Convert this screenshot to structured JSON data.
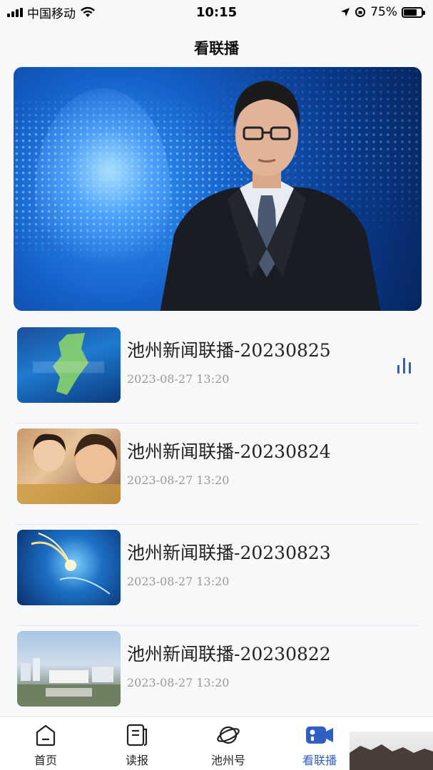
{
  "status_bar": {
    "carrier": "中国移动",
    "time": "10:15",
    "battery": "75%",
    "battery_level": 0.75
  },
  "header": {
    "title": "看联播"
  },
  "hero": {
    "icon": "video-player"
  },
  "news": [
    {
      "title": "池州新闻联播-20230825",
      "time": "2023-08-27 13:20",
      "playing": true
    },
    {
      "title": "池州新闻联播-20230824",
      "time": "2023-08-27 13:20",
      "playing": false
    },
    {
      "title": "池州新闻联播-20230823",
      "time": "2023-08-27 13:20",
      "playing": false
    },
    {
      "title": "池州新闻联播-20230822",
      "time": "2023-08-27 13:20",
      "playing": false
    }
  ],
  "tabs": [
    {
      "label": "首页",
      "icon": "home-icon",
      "active": false
    },
    {
      "label": "读报",
      "icon": "newspaper-icon",
      "active": false
    },
    {
      "label": "池州号",
      "icon": "planet-icon",
      "active": false
    },
    {
      "label": "看联播",
      "icon": "video-camera-icon",
      "active": true
    }
  ],
  "colors": {
    "accent": "#2f5fc2",
    "background": "#f7f8fa",
    "muted_text": "#999999"
  }
}
